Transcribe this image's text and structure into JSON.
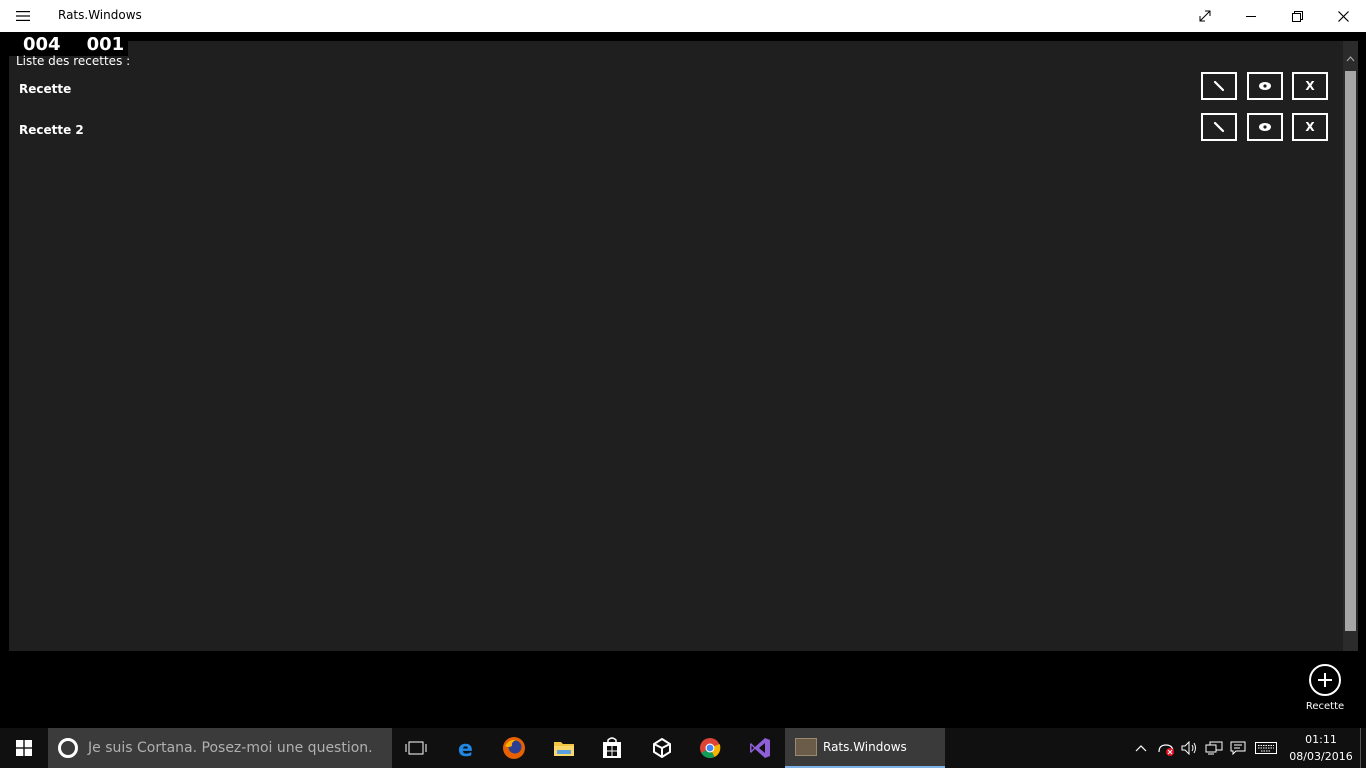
{
  "window": {
    "title": "Rats.Windows"
  },
  "counters": {
    "left": "004",
    "right": "001"
  },
  "list": {
    "title": "Liste des recettes :",
    "items": [
      {
        "name": "Recette",
        "edit_label": "✎",
        "view_label": "👁",
        "delete_label": "X"
      },
      {
        "name": "Recette 2",
        "edit_label": "✎",
        "view_label": "👁",
        "delete_label": "X"
      }
    ]
  },
  "add_button": {
    "label": "Recette"
  },
  "taskbar": {
    "search_placeholder": "Je suis Cortana. Posez-moi une question.",
    "active_app": "Rats.Windows",
    "time": "01:11",
    "date": "08/03/2016"
  },
  "colors": {
    "panel_bg": "#1f1f1f",
    "titlebar_bg": "#ffffff",
    "taskbar_bg": "#101010",
    "accent": "#7fb2e5"
  }
}
